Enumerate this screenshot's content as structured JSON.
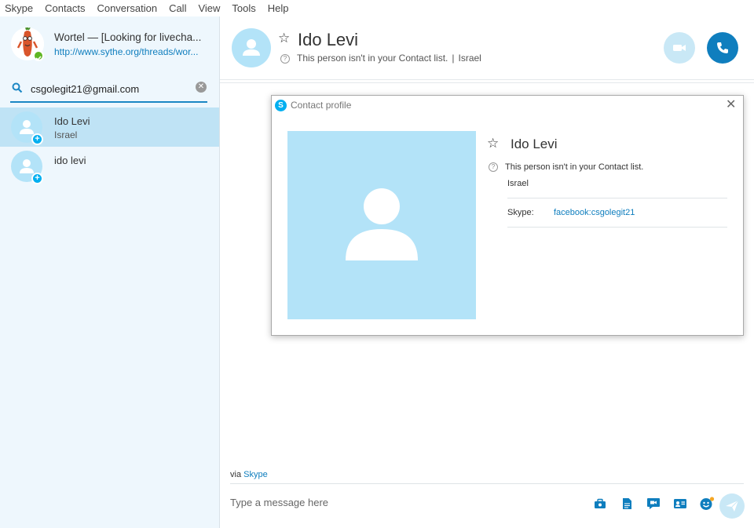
{
  "menu": [
    "Skype",
    "Contacts",
    "Conversation",
    "Call",
    "View",
    "Tools",
    "Help"
  ],
  "me": {
    "name": "Wortel — [Looking for livecha...",
    "mood": "http://www.sythe.org/threads/wor...",
    "status_color": "#5fb623"
  },
  "search": {
    "value": "csgolegit21@gmail.com",
    "icon": "search-icon"
  },
  "contacts": [
    {
      "name": "Ido Levi",
      "sub": "Israel",
      "selected": true
    },
    {
      "name": "ido levi",
      "sub": "",
      "selected": false
    }
  ],
  "header": {
    "name": "Ido Levi",
    "info": "This person isn't in your Contact list.",
    "separator": "|",
    "location": "Israel"
  },
  "composer": {
    "via_label": "via",
    "via_link": "Skype",
    "placeholder": "Type a message here"
  },
  "dialog": {
    "title": "Contact profile",
    "name": "Ido Levi",
    "status": "This person isn't in your Contact list.",
    "location": "Israel",
    "skype_label": "Skype:",
    "skype_value": "facebook:csgolegit21"
  },
  "colors": {
    "accent": "#0f7ebe",
    "avatar_bg": "#b3e3f8",
    "sidebar_bg": "#eef7fd",
    "selected_bg": "#bfe3f5"
  }
}
